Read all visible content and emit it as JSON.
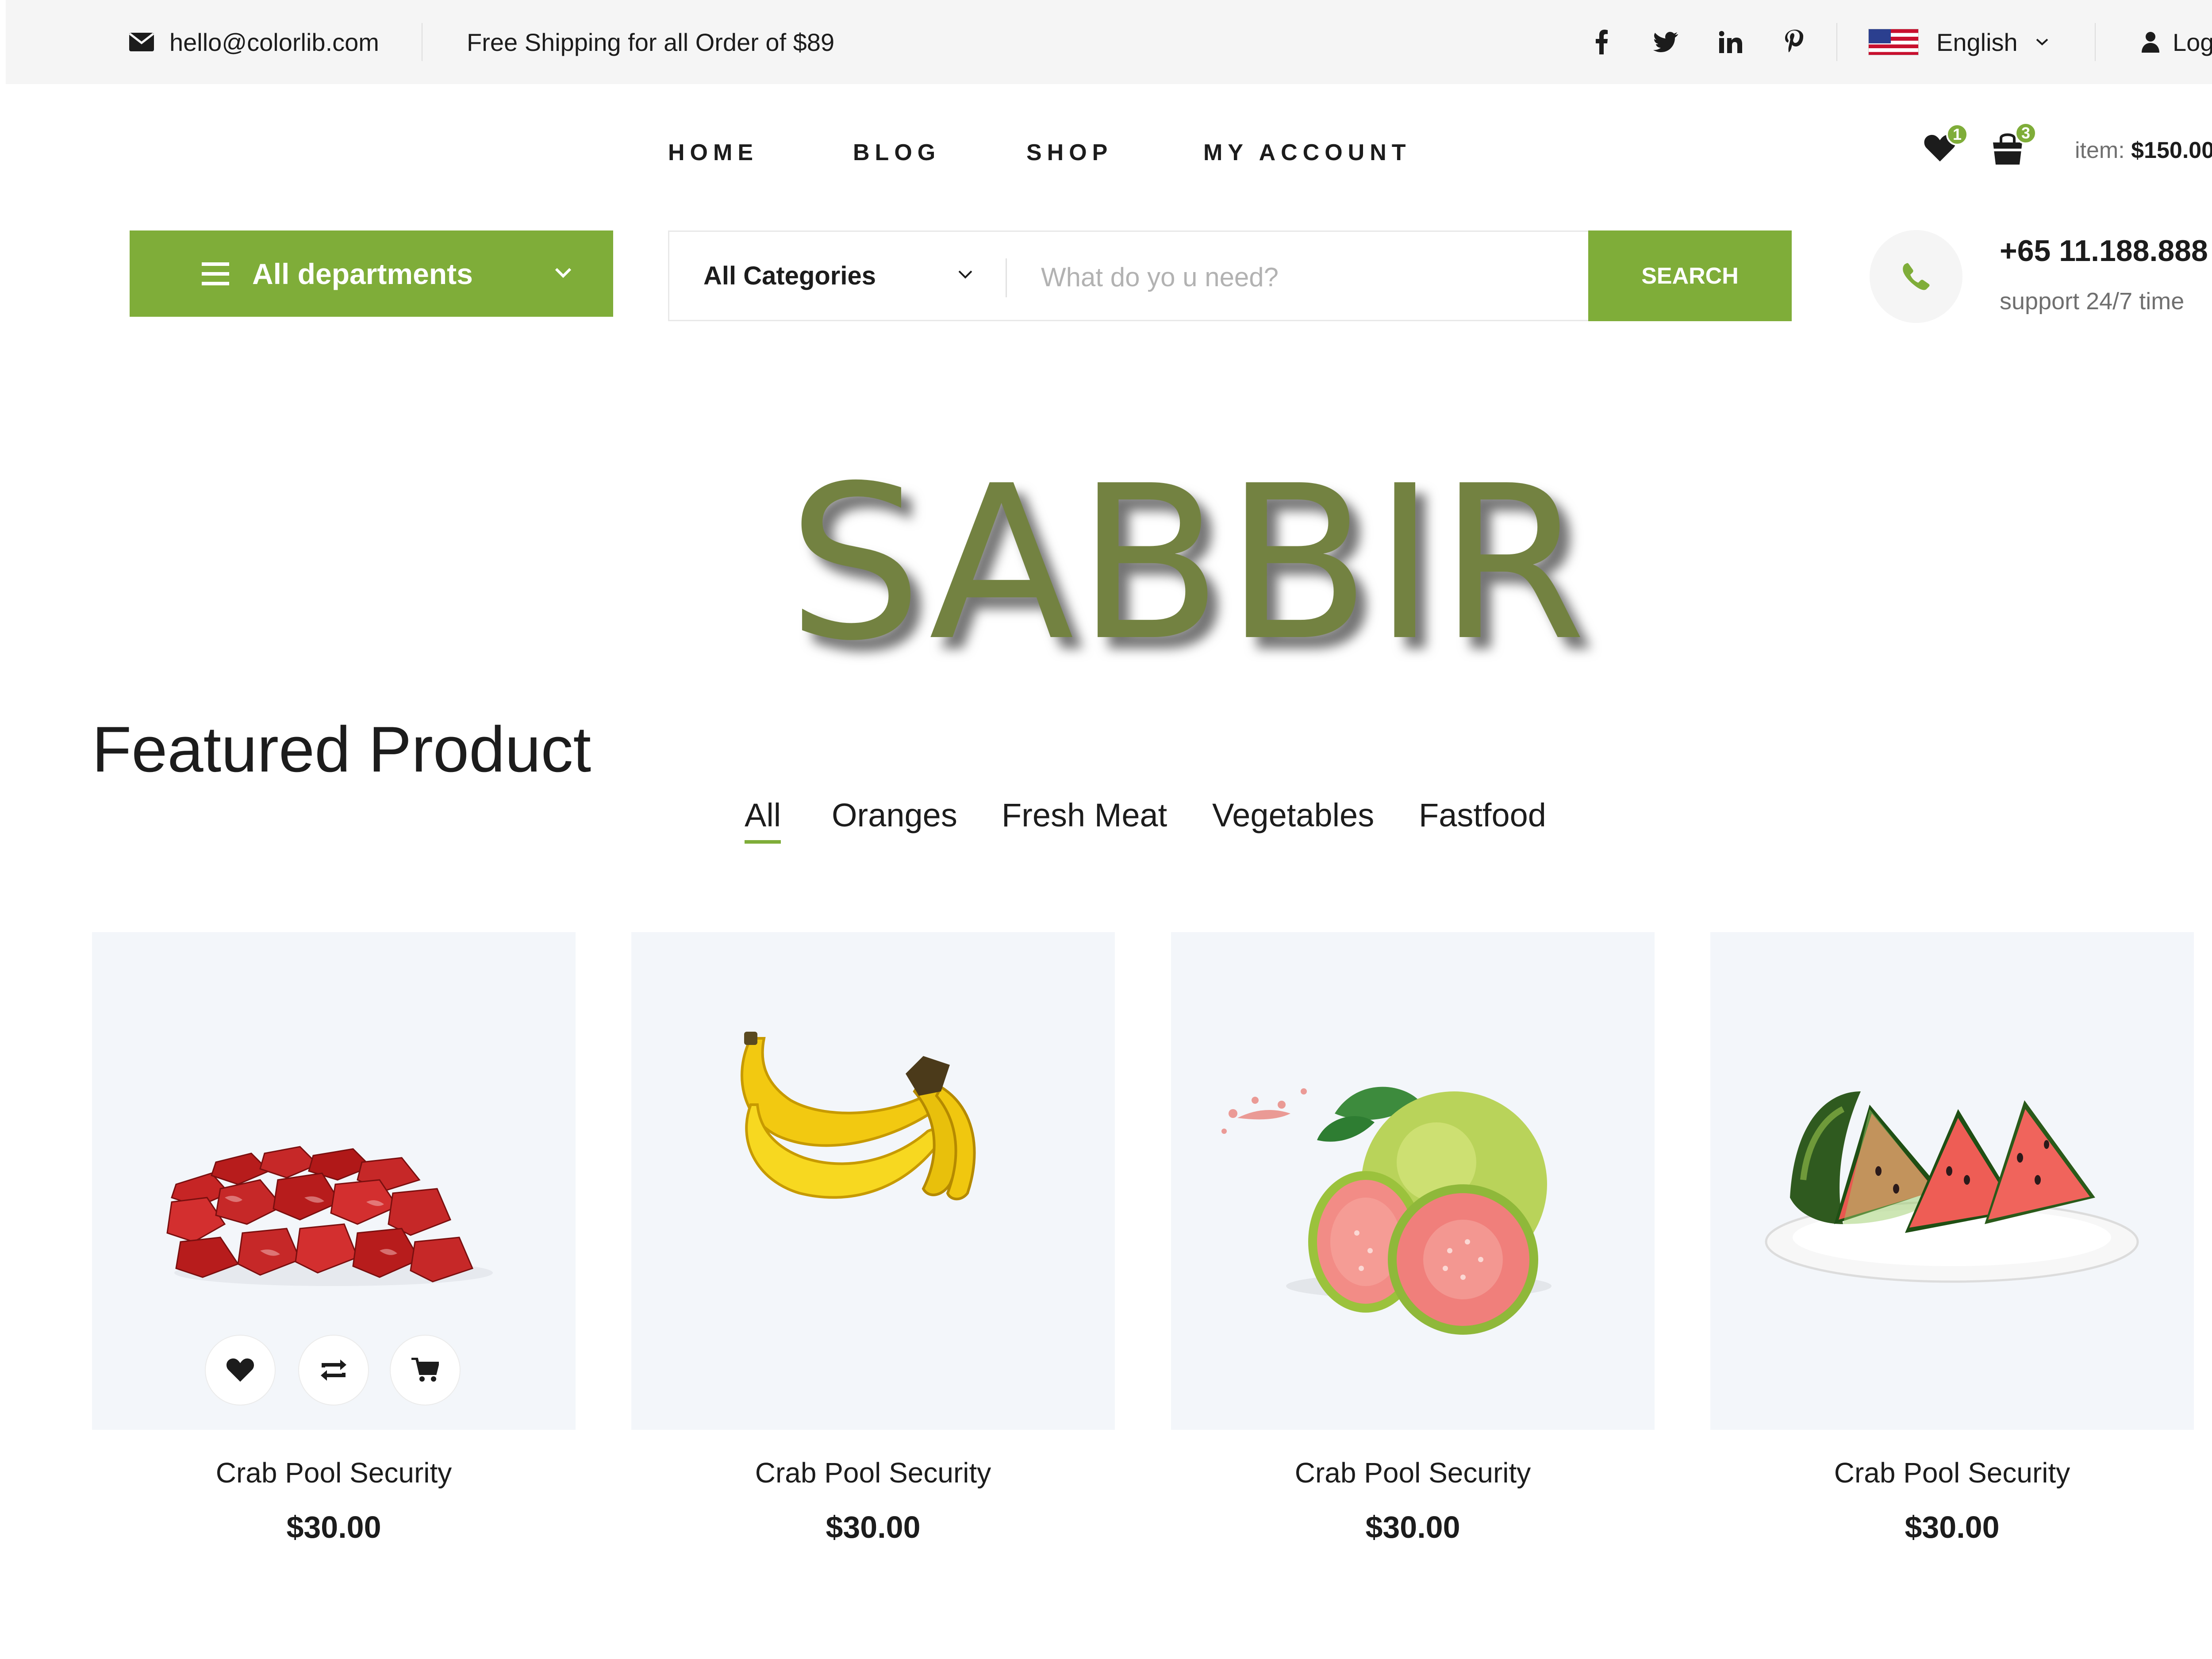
{
  "topbar": {
    "email": "hello@colorlib.com",
    "shipping": "Free Shipping for all Order of $89",
    "social_icons": [
      "facebook-icon",
      "twitter-icon",
      "linkedin-icon",
      "pinterest-icon"
    ],
    "language": "English",
    "login": "Login"
  },
  "nav": {
    "items": [
      "HOME",
      "BLOG",
      "SHOP",
      "MY ACCOUNT"
    ]
  },
  "header_cart": {
    "wishlist_count": "1",
    "cart_count": "3",
    "item_label": "item:",
    "total": "$150.00"
  },
  "departments": {
    "label": "All departments"
  },
  "search": {
    "category": "All Categories",
    "placeholder": "What do yo u need?",
    "button": "SEARCH"
  },
  "support": {
    "phone": "+65 11.188.888",
    "text": "support 24/7 time"
  },
  "banner": {
    "text": "SABBIR"
  },
  "featured": {
    "title": "Featured Product",
    "filters": [
      "All",
      "Oranges",
      "Fresh Meat",
      "Vegetables",
      "Fastfood"
    ],
    "active_filter": "All",
    "products": [
      {
        "name": "Crab Pool Security",
        "price": "$30.00",
        "image": "meat-cubes"
      },
      {
        "name": "Crab Pool Security",
        "price": "$30.00",
        "image": "bananas"
      },
      {
        "name": "Crab Pool Security",
        "price": "$30.00",
        "image": "guava"
      },
      {
        "name": "Crab Pool Security",
        "price": "$30.00",
        "image": "watermelon"
      }
    ]
  },
  "colors": {
    "accent": "#7fad39",
    "banner_text": "#738241",
    "topbar_bg": "#f5f5f5",
    "card_bg": "#f3f6fa"
  }
}
